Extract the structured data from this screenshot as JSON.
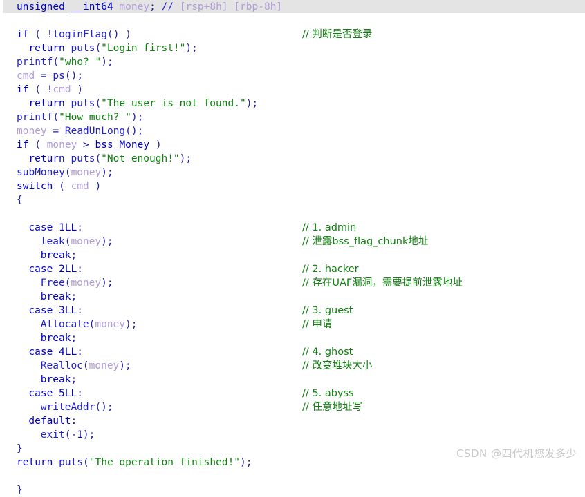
{
  "view": {
    "title": "IDA Pseudocode",
    "highlight_color": "#e4e4e4",
    "background_color": "#ffffff"
  },
  "colors": {
    "keyword": "#0000c0",
    "function": "#2020d0",
    "local_variable": "#b09cd8",
    "string": "#108010",
    "comment": "#108010",
    "punctuation": "#20209a",
    "watermark": "#c9c9c9"
  },
  "watermark": {
    "text": "CSDN @四代机您发多少"
  },
  "code": {
    "lines": [
      {
        "id": "decl-money",
        "highlighted": true,
        "indent": 0,
        "tokens": [
          {
            "t": "unsigned",
            "c": "t-type"
          },
          {
            "t": " ",
            "c": "t-plain"
          },
          {
            "t": "__int64",
            "c": "t-type"
          },
          {
            "t": " ",
            "c": "t-plain"
          },
          {
            "t": "money",
            "c": "t-lvar"
          },
          {
            "t": ";",
            "c": "t-punct"
          },
          {
            "t": " ",
            "c": "t-plain"
          },
          {
            "t": "//",
            "c": "t-cmt-slash"
          },
          {
            "t": " [rsp+8h] [rbp-8h]",
            "c": "t-cmt-var"
          }
        ],
        "comment": null
      },
      {
        "id": "blank-1",
        "indent": 0,
        "tokens": [],
        "comment": null
      },
      {
        "id": "if-loginflag",
        "indent": 0,
        "tokens": [
          {
            "t": "if",
            "c": "t-kw"
          },
          {
            "t": " ( ",
            "c": "t-punct"
          },
          {
            "t": "!",
            "c": "t-punct"
          },
          {
            "t": "loginFlag",
            "c": "t-fn"
          },
          {
            "t": "() )",
            "c": "t-punct"
          }
        ],
        "comment": "// 判断是否登录"
      },
      {
        "id": "return-login-first",
        "indent": 2,
        "tokens": [
          {
            "t": "return",
            "c": "t-kw"
          },
          {
            "t": " ",
            "c": "t-plain"
          },
          {
            "t": "puts",
            "c": "t-fn"
          },
          {
            "t": "(",
            "c": "t-punct"
          },
          {
            "t": "\"Login first!\"",
            "c": "t-str"
          },
          {
            "t": ");",
            "c": "t-punct"
          }
        ],
        "comment": null
      },
      {
        "id": "printf-who",
        "indent": 0,
        "tokens": [
          {
            "t": "printf",
            "c": "t-fn"
          },
          {
            "t": "(",
            "c": "t-punct"
          },
          {
            "t": "\"who? \"",
            "c": "t-str"
          },
          {
            "t": ");",
            "c": "t-punct"
          }
        ],
        "comment": null
      },
      {
        "id": "cmd-assign-ps",
        "indent": 0,
        "tokens": [
          {
            "t": "cmd",
            "c": "t-lvar"
          },
          {
            "t": " = ",
            "c": "t-punct"
          },
          {
            "t": "ps",
            "c": "t-fn"
          },
          {
            "t": "();",
            "c": "t-punct"
          }
        ],
        "comment": null
      },
      {
        "id": "if-not-cmd",
        "indent": 0,
        "tokens": [
          {
            "t": "if",
            "c": "t-kw"
          },
          {
            "t": " ( ",
            "c": "t-punct"
          },
          {
            "t": "!",
            "c": "t-punct"
          },
          {
            "t": "cmd",
            "c": "t-lvar"
          },
          {
            "t": " )",
            "c": "t-punct"
          }
        ],
        "comment": null
      },
      {
        "id": "return-user-not-found",
        "indent": 2,
        "tokens": [
          {
            "t": "return",
            "c": "t-kw"
          },
          {
            "t": " ",
            "c": "t-plain"
          },
          {
            "t": "puts",
            "c": "t-fn"
          },
          {
            "t": "(",
            "c": "t-punct"
          },
          {
            "t": "\"The user is not found.\"",
            "c": "t-str"
          },
          {
            "t": ");",
            "c": "t-punct"
          }
        ],
        "comment": null
      },
      {
        "id": "printf-how-much",
        "indent": 0,
        "tokens": [
          {
            "t": "printf",
            "c": "t-fn"
          },
          {
            "t": "(",
            "c": "t-punct"
          },
          {
            "t": "\"How much? \"",
            "c": "t-str"
          },
          {
            "t": ");",
            "c": "t-punct"
          }
        ],
        "comment": null
      },
      {
        "id": "money-assign-readunlong",
        "indent": 0,
        "tokens": [
          {
            "t": "money",
            "c": "t-lvar"
          },
          {
            "t": " = ",
            "c": "t-punct"
          },
          {
            "t": "ReadUnLong",
            "c": "t-fn"
          },
          {
            "t": "();",
            "c": "t-punct"
          }
        ],
        "comment": null
      },
      {
        "id": "if-money-gt-bssmoney",
        "indent": 0,
        "tokens": [
          {
            "t": "if",
            "c": "t-kw"
          },
          {
            "t": " ( ",
            "c": "t-punct"
          },
          {
            "t": "money",
            "c": "t-lvar"
          },
          {
            "t": " > ",
            "c": "t-punct"
          },
          {
            "t": "bss_Money",
            "c": "t-gvar"
          },
          {
            "t": " )",
            "c": "t-punct"
          }
        ],
        "comment": null
      },
      {
        "id": "return-not-enough",
        "indent": 2,
        "tokens": [
          {
            "t": "return",
            "c": "t-kw"
          },
          {
            "t": " ",
            "c": "t-plain"
          },
          {
            "t": "puts",
            "c": "t-fn"
          },
          {
            "t": "(",
            "c": "t-punct"
          },
          {
            "t": "\"Not enough!\"",
            "c": "t-str"
          },
          {
            "t": ");",
            "c": "t-punct"
          }
        ],
        "comment": null
      },
      {
        "id": "submoney-call",
        "indent": 0,
        "tokens": [
          {
            "t": "subMoney",
            "c": "t-fn"
          },
          {
            "t": "(",
            "c": "t-punct"
          },
          {
            "t": "money",
            "c": "t-lvar"
          },
          {
            "t": ");",
            "c": "t-punct"
          }
        ],
        "comment": null
      },
      {
        "id": "switch-cmd",
        "indent": 0,
        "tokens": [
          {
            "t": "switch",
            "c": "t-kw"
          },
          {
            "t": " ( ",
            "c": "t-punct"
          },
          {
            "t": "cmd",
            "c": "t-lvar"
          },
          {
            "t": " )",
            "c": "t-punct"
          }
        ],
        "comment": null
      },
      {
        "id": "switch-open-brace",
        "indent": 0,
        "tokens": [
          {
            "t": "{",
            "c": "t-punct"
          }
        ],
        "comment": null
      },
      {
        "id": "blank-2",
        "indent": 0,
        "tokens": [],
        "comment": null
      },
      {
        "id": "case-1",
        "indent": 2,
        "tokens": [
          {
            "t": "case",
            "c": "t-kw"
          },
          {
            "t": " ",
            "c": "t-plain"
          },
          {
            "t": "1LL",
            "c": "t-num"
          },
          {
            "t": ":",
            "c": "t-punct"
          }
        ],
        "comment": "// 1. admin"
      },
      {
        "id": "call-leak",
        "indent": 4,
        "tokens": [
          {
            "t": "leak",
            "c": "t-fn"
          },
          {
            "t": "(",
            "c": "t-punct"
          },
          {
            "t": "money",
            "c": "t-lvar"
          },
          {
            "t": ");",
            "c": "t-punct"
          }
        ],
        "comment": "// 泄露bss_flag_chunk地址"
      },
      {
        "id": "break-1",
        "indent": 4,
        "tokens": [
          {
            "t": "break",
            "c": "t-kw"
          },
          {
            "t": ";",
            "c": "t-punct"
          }
        ],
        "comment": null
      },
      {
        "id": "case-2",
        "indent": 2,
        "tokens": [
          {
            "t": "case",
            "c": "t-kw"
          },
          {
            "t": " ",
            "c": "t-plain"
          },
          {
            "t": "2LL",
            "c": "t-num"
          },
          {
            "t": ":",
            "c": "t-punct"
          }
        ],
        "comment": "// 2. hacker"
      },
      {
        "id": "call-free",
        "indent": 4,
        "tokens": [
          {
            "t": "Free",
            "c": "t-fn"
          },
          {
            "t": "(",
            "c": "t-punct"
          },
          {
            "t": "money",
            "c": "t-lvar"
          },
          {
            "t": ");",
            "c": "t-punct"
          }
        ],
        "comment": "// 存在UAF漏洞，需要提前泄露地址"
      },
      {
        "id": "break-2",
        "indent": 4,
        "tokens": [
          {
            "t": "break",
            "c": "t-kw"
          },
          {
            "t": ";",
            "c": "t-punct"
          }
        ],
        "comment": null
      },
      {
        "id": "case-3",
        "indent": 2,
        "tokens": [
          {
            "t": "case",
            "c": "t-kw"
          },
          {
            "t": " ",
            "c": "t-plain"
          },
          {
            "t": "3LL",
            "c": "t-num"
          },
          {
            "t": ":",
            "c": "t-punct"
          }
        ],
        "comment": "// 3. guest"
      },
      {
        "id": "call-allocate",
        "indent": 4,
        "tokens": [
          {
            "t": "Allocate",
            "c": "t-fn"
          },
          {
            "t": "(",
            "c": "t-punct"
          },
          {
            "t": "money",
            "c": "t-lvar"
          },
          {
            "t": ");",
            "c": "t-punct"
          }
        ],
        "comment": "// 申请"
      },
      {
        "id": "break-3",
        "indent": 4,
        "tokens": [
          {
            "t": "break",
            "c": "t-kw"
          },
          {
            "t": ";",
            "c": "t-punct"
          }
        ],
        "comment": null
      },
      {
        "id": "case-4",
        "indent": 2,
        "tokens": [
          {
            "t": "case",
            "c": "t-kw"
          },
          {
            "t": " ",
            "c": "t-plain"
          },
          {
            "t": "4LL",
            "c": "t-num"
          },
          {
            "t": ":",
            "c": "t-punct"
          }
        ],
        "comment": "// 4. ghost"
      },
      {
        "id": "call-realloc",
        "indent": 4,
        "tokens": [
          {
            "t": "Realloc",
            "c": "t-fn"
          },
          {
            "t": "(",
            "c": "t-punct"
          },
          {
            "t": "money",
            "c": "t-lvar"
          },
          {
            "t": ");",
            "c": "t-punct"
          }
        ],
        "comment": "// 改变堆块大小"
      },
      {
        "id": "break-4",
        "indent": 4,
        "tokens": [
          {
            "t": "break",
            "c": "t-kw"
          },
          {
            "t": ";",
            "c": "t-punct"
          }
        ],
        "comment": null
      },
      {
        "id": "case-5",
        "indent": 2,
        "tokens": [
          {
            "t": "case",
            "c": "t-kw"
          },
          {
            "t": " ",
            "c": "t-plain"
          },
          {
            "t": "5LL",
            "c": "t-num"
          },
          {
            "t": ":",
            "c": "t-punct"
          }
        ],
        "comment": "// 5. abyss"
      },
      {
        "id": "call-writeaddr",
        "indent": 4,
        "tokens": [
          {
            "t": "writeAddr",
            "c": "t-fn"
          },
          {
            "t": "();",
            "c": "t-punct"
          }
        ],
        "comment": "// 任意地址写"
      },
      {
        "id": "default-label",
        "indent": 2,
        "tokens": [
          {
            "t": "default",
            "c": "t-kw"
          },
          {
            "t": ":",
            "c": "t-punct"
          }
        ],
        "comment": null
      },
      {
        "id": "call-exit",
        "indent": 4,
        "tokens": [
          {
            "t": "exit",
            "c": "t-fn"
          },
          {
            "t": "(",
            "c": "t-punct"
          },
          {
            "t": "-1",
            "c": "t-num"
          },
          {
            "t": ");",
            "c": "t-punct"
          }
        ],
        "comment": null
      },
      {
        "id": "switch-close-brace",
        "indent": 0,
        "tokens": [
          {
            "t": "}",
            "c": "t-punct"
          }
        ],
        "comment": null
      },
      {
        "id": "return-operation-finished",
        "indent": 0,
        "tokens": [
          {
            "t": "return",
            "c": "t-kw"
          },
          {
            "t": " ",
            "c": "t-plain"
          },
          {
            "t": "puts",
            "c": "t-fn"
          },
          {
            "t": "(",
            "c": "t-punct"
          },
          {
            "t": "\"The operation finished!\"",
            "c": "t-str"
          },
          {
            "t": ");",
            "c": "t-punct"
          }
        ],
        "comment": null
      },
      {
        "id": "blank-3",
        "indent": 0,
        "tokens": [],
        "comment": null
      },
      {
        "id": "function-close-brace",
        "indent": 0,
        "tokens": [
          {
            "t": "}",
            "c": "t-punct"
          }
        ],
        "comment": null
      }
    ]
  }
}
